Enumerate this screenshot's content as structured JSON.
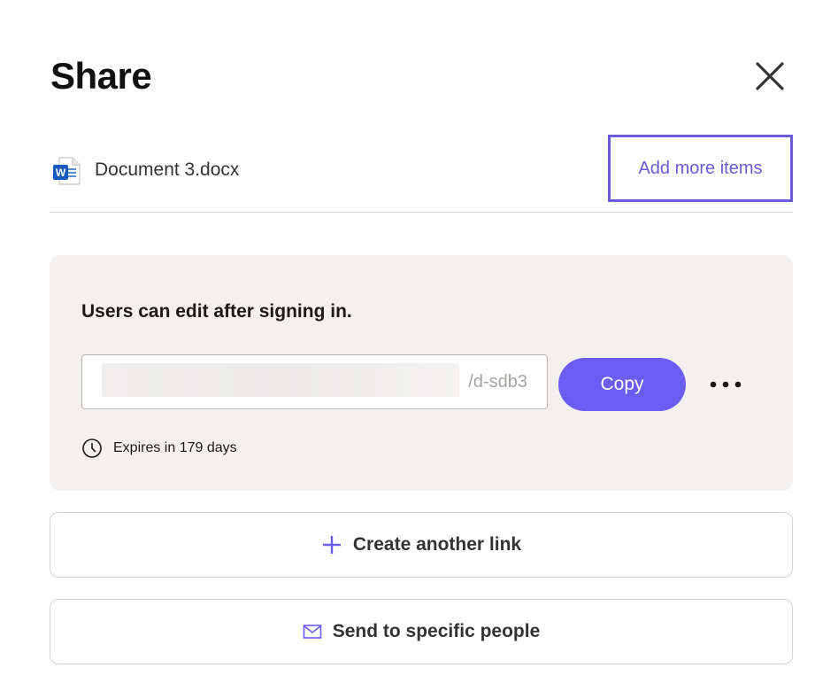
{
  "dialog": {
    "title": "Share",
    "close_icon": "close-icon"
  },
  "file": {
    "name": "Document 3.docx",
    "icon": "word-document-icon",
    "add_more_label": "Add more items"
  },
  "link": {
    "permission_text": "Users can edit after signing in.",
    "url_visible_suffix": "/d-sdb3",
    "copy_label": "Copy",
    "more_icon": "more-options-icon",
    "expiry_text": "Expires in 179 days",
    "expiry_icon": "clock-icon"
  },
  "actions": {
    "create_link_label": "Create another link",
    "create_link_icon": "plus-icon",
    "send_people_label": "Send to specific people",
    "send_people_icon": "envelope-icon"
  },
  "colors": {
    "accent": "#6b5cf2",
    "accent_border": "#6b5bd8",
    "panel_bg": "#f2f1f0",
    "word_blue": "#185abd"
  }
}
